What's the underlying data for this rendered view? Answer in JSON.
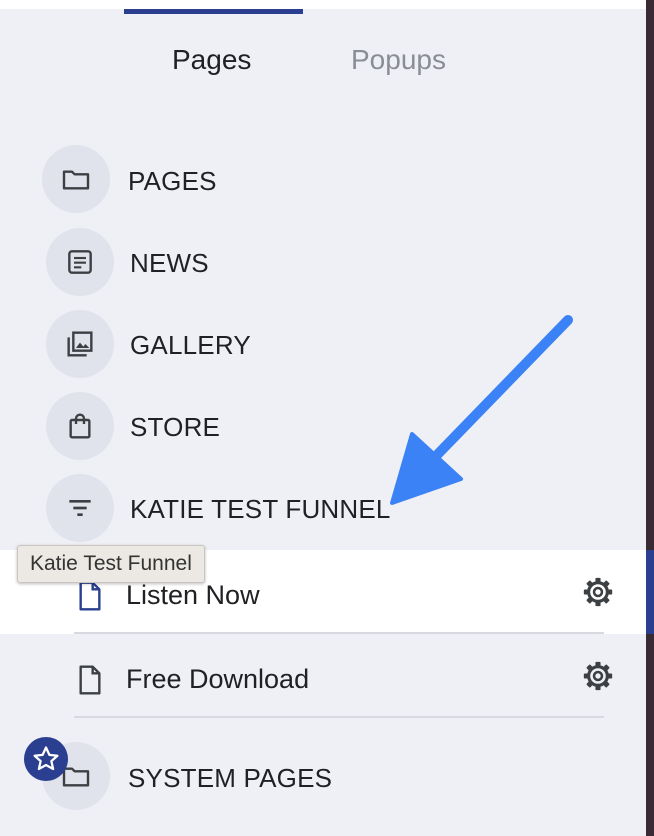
{
  "tabs": [
    {
      "label": "Pages",
      "active": true
    },
    {
      "label": "Popups",
      "active": false
    }
  ],
  "nav": {
    "pages": {
      "label": "PAGES",
      "icon": "folder-icon"
    },
    "news": {
      "label": "NEWS",
      "icon": "article-icon"
    },
    "gallery": {
      "label": "GALLERY",
      "icon": "gallery-icon"
    },
    "store": {
      "label": "STORE",
      "icon": "shopping-bag-icon"
    },
    "funnel": {
      "label": "KATIE TEST FUNNEL",
      "icon": "filter-icon"
    },
    "system": {
      "label": "SYSTEM PAGES",
      "icon": "folder-icon"
    }
  },
  "tooltip": {
    "text": "Katie Test Funnel"
  },
  "funnel_pages": [
    {
      "label": "Listen Now",
      "active": true,
      "icon": "document-icon"
    },
    {
      "label": "Free Download",
      "active": false,
      "icon": "document-icon"
    }
  ],
  "colors": {
    "accent": "#2a3f8f",
    "arrow": "#3b82f6",
    "panel_bg": "#eff0f6",
    "icon_circle": "#e1e3ec",
    "active_row": "#ffffff"
  }
}
